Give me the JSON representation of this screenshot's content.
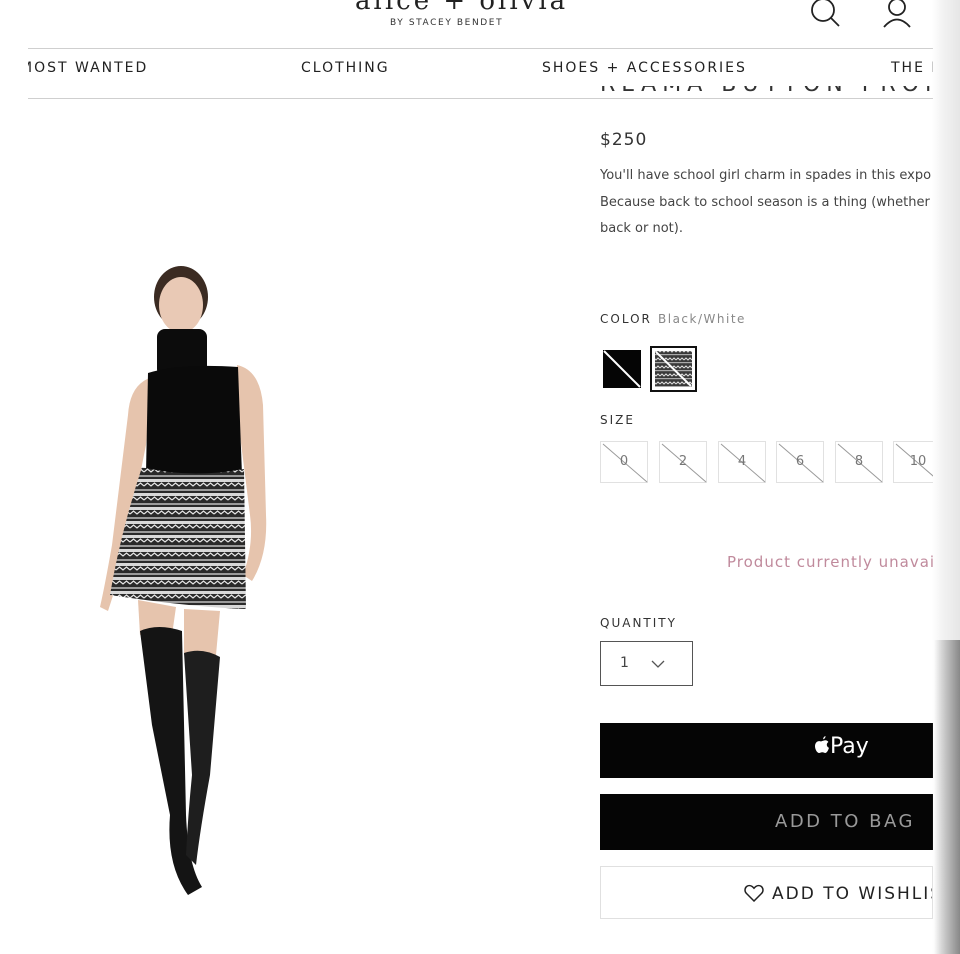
{
  "header": {
    "brand": "alice + olivia",
    "brand_sub": "BY STACEY BENDET",
    "icons": [
      "search-icon",
      "account-icon"
    ]
  },
  "nav": {
    "items": [
      {
        "label": "MOST WANTED"
      },
      {
        "label": "CLOTHING"
      },
      {
        "label": "SHOES + ACCESSORIES"
      },
      {
        "label": "THE E"
      }
    ]
  },
  "product": {
    "title_partial": "REAMA BUTTON FRONT S",
    "price": "$250",
    "description_lines": [
      "You'll have school girl charm in spades in this expo",
      "Because back to school season is a thing (whether",
      "back or not)."
    ],
    "image_alt": "Model wearing black sleeveless turtleneck, black and white patterned mini skirt and black over-the-knee boots",
    "color": {
      "label": "COLOR",
      "value": "Black/White",
      "swatches": [
        {
          "name": "black",
          "selected": false
        },
        {
          "name": "black-white-pattern",
          "selected": true
        }
      ]
    },
    "size": {
      "label": "SIZE",
      "options": [
        "0",
        "2",
        "4",
        "6",
        "8",
        "10"
      ]
    },
    "availability": "Product currently unavaila",
    "quantity": {
      "label": "QUANTITY",
      "value": "1"
    },
    "apple_pay_label": "Pay",
    "add_to_bag_label": "ADD TO BAG",
    "wishlist_label": "ADD TO WISHLIST",
    "colors": {
      "accent_pink": "#c08a9c",
      "button_black": "#050505"
    }
  }
}
